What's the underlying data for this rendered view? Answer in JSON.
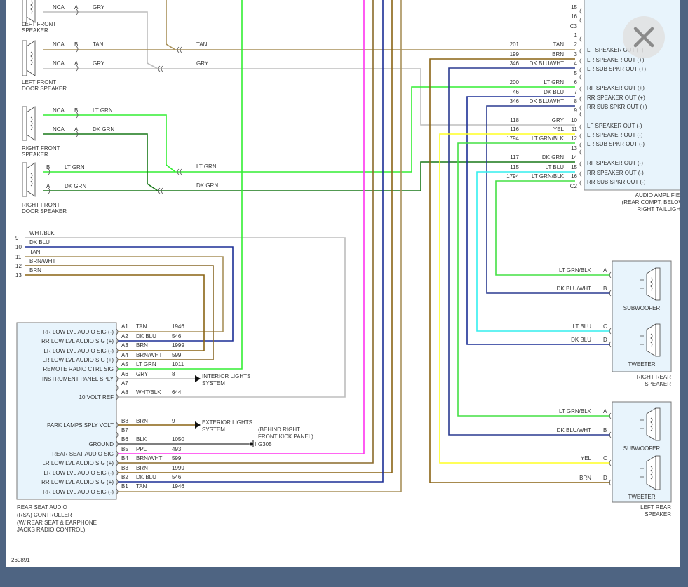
{
  "viewer": {
    "close_icon": "close-icon"
  },
  "wire_colors": {
    "TAN": "#a8915a",
    "BRN": "#8a6414",
    "BRN/WHT": "#8a6a2a",
    "DK BLU": "#1c2e96",
    "DK BLU/WHT": "#2a3a90",
    "LT GRN": "#33ee33",
    "LT GRN/BLK": "#44e044",
    "DK GRN": "#187818",
    "GRY": "#bdbdbd",
    "WHT/BLK": "#bdbdbd",
    "YEL": "#ffff22",
    "LT BLU": "#33eeee",
    "PPL": "#ff33ee",
    "BLK": "#555555"
  },
  "diagram": {
    "id": "260891",
    "left_front_speaker": {
      "name": [
        "LEFT FRONT",
        "SPEAKER"
      ],
      "pins": [
        {
          "nca": "NCA",
          "pin": "A",
          "color": "GRY"
        }
      ]
    },
    "left_front_door_speaker": {
      "name": [
        "LEFT FRONT",
        "DOOR SPEAKER"
      ],
      "pins": [
        {
          "nca": "NCA",
          "pin": "B",
          "color": "TAN"
        },
        {
          "nca": "NCA",
          "pin": "A",
          "color": "GRY"
        }
      ]
    },
    "right_front_speaker": {
      "name": [
        "RIGHT FRONT",
        "SPEAKER"
      ],
      "pins": [
        {
          "nca": "NCA",
          "pin": "B",
          "color": "LT GRN"
        },
        {
          "nca": "NCA",
          "pin": "A",
          "color": "DK GRN"
        }
      ]
    },
    "right_front_door_speaker": {
      "name": [
        "RIGHT FRONT",
        "DOOR SPEAKER"
      ],
      "pins": [
        {
          "pin": "B",
          "color": "LT GRN"
        },
        {
          "pin": "A",
          "color": "DK GRN"
        }
      ]
    },
    "inline_labels": [
      "TAN",
      "GRY",
      "LT GRN",
      "DK GRN"
    ],
    "harness": [
      {
        "num": "9",
        "color": "WHT/BLK"
      },
      {
        "num": "10",
        "color": "DK BLU"
      },
      {
        "num": "11",
        "color": "TAN"
      },
      {
        "num": "12",
        "color": "BRN/WHT"
      },
      {
        "num": "13",
        "color": "BRN"
      }
    ],
    "amplifier": {
      "name": [
        "AUDIO AMPLIFIER",
        "(REAR COMPT, BELOW",
        "RIGHT TAILLIGHT"
      ],
      "connectors": [
        "C3",
        "C2"
      ],
      "pins": [
        {
          "num": "15"
        },
        {
          "num": "16"
        },
        {
          "num": "1"
        },
        {
          "num": "2",
          "circuit": "201",
          "color": "TAN",
          "function": "LF SPEAKER OUT (+)"
        },
        {
          "num": "3",
          "circuit": "199",
          "color": "BRN",
          "function": "LR SPEAKER OUT (+)"
        },
        {
          "num": "4",
          "circuit": "346",
          "color": "DK BLU/WHT",
          "function": "LR SUB SPKR OUT (+)"
        },
        {
          "num": "5"
        },
        {
          "num": "6",
          "circuit": "200",
          "color": "LT GRN",
          "function": "RF SPEAKER OUT (+)"
        },
        {
          "num": "7",
          "circuit": "46",
          "color": "DK BLU",
          "function": "RR SPEAKER OUT (+)"
        },
        {
          "num": "8",
          "circuit": "346",
          "color": "DK BLU/WHT",
          "function": "RR SUB SPKR OUT (+)"
        },
        {
          "num": "9"
        },
        {
          "num": "10",
          "circuit": "118",
          "color": "GRY",
          "function": "LF SPEAKER OUT (-)"
        },
        {
          "num": "11",
          "circuit": "116",
          "color": "YEL",
          "function": "LR SPEAKER OUT (-)"
        },
        {
          "num": "12",
          "circuit": "1794",
          "color": "LT GRN/BLK",
          "function": "LR SUB SPKR OUT (-)"
        },
        {
          "num": "13"
        },
        {
          "num": "14",
          "circuit": "117",
          "color": "DK GRN",
          "function": "RF SPEAKER OUT (-)"
        },
        {
          "num": "15",
          "circuit": "115",
          "color": "LT BLU",
          "function": "RR SPEAKER OUT (-)"
        },
        {
          "num": "16",
          "circuit": "1794",
          "color": "LT GRN/BLK",
          "function": "RR SUB SPKR OUT (-)"
        }
      ]
    },
    "right_rear_speaker": {
      "name": [
        "RIGHT REAR",
        "SPEAKER"
      ],
      "subwoofer": "SUBWOOFER",
      "tweeter": "TWEETER",
      "pins": [
        {
          "pin": "A",
          "color": "LT GRN/BLK"
        },
        {
          "pin": "B",
          "color": "DK BLU/WHT"
        },
        {
          "pin": "C",
          "color": "LT BLU"
        },
        {
          "pin": "D",
          "color": "DK BLU"
        }
      ]
    },
    "left_rear_speaker": {
      "name": [
        "LEFT REAR",
        "SPEAKER"
      ],
      "subwoofer": "SUBWOOFER",
      "tweeter": "TWEETER",
      "pins": [
        {
          "pin": "A",
          "color": "LT GRN/BLK"
        },
        {
          "pin": "B",
          "color": "DK BLU/WHT"
        },
        {
          "pin": "C",
          "color": "YEL"
        },
        {
          "pin": "D",
          "color": "BRN"
        }
      ]
    },
    "rsa_controller": {
      "name": [
        "REAR SEAT AUDIO",
        "(RSA) CONTROLLER",
        "(W/ REAR SEAT & EARPHONE",
        "JACKS RADIO CONTROL)"
      ],
      "pins": [
        {
          "pin": "A1",
          "color": "TAN",
          "circuit": "1946",
          "function": "RR LOW LVL AUDIO SIG (-)"
        },
        {
          "pin": "A2",
          "color": "DK BLU",
          "circuit": "546",
          "function": "RR LOW LVL AUDIO SIG (+)"
        },
        {
          "pin": "A3",
          "color": "BRN",
          "circuit": "1999",
          "function": "LR LOW LVL AUDIO SIG (-)"
        },
        {
          "pin": "A4",
          "color": "BRN/WHT",
          "circuit": "599",
          "function": "LR LOW LVL AUDIO SIG (+)"
        },
        {
          "pin": "A5",
          "color": "LT GRN",
          "circuit": "1011",
          "function": "REMOTE RADIO CTRL SIG"
        },
        {
          "pin": "A6",
          "color": "GRY",
          "circuit": "8",
          "function": "INSTRUMENT PANEL SPLY"
        },
        {
          "pin": "A7"
        },
        {
          "pin": "A8",
          "color": "WHT/BLK",
          "circuit": "644",
          "function": "10 VOLT REF"
        },
        {
          "pin": "B8",
          "color": "BRN",
          "circuit": "9",
          "function": "PARK LAMPS SPLY VOLT"
        },
        {
          "pin": "B7"
        },
        {
          "pin": "B6",
          "color": "BLK",
          "circuit": "1050",
          "function": "GROUND"
        },
        {
          "pin": "B5",
          "color": "PPL",
          "circuit": "493",
          "function": "REAR SEAT AUDIO SIG"
        },
        {
          "pin": "B4",
          "color": "BRN/WHT",
          "circuit": "599",
          "function": "LR LOW LVL AUDIO SIG (+)"
        },
        {
          "pin": "B3",
          "color": "BRN",
          "circuit": "1999",
          "function": "LR LOW LVL AUDIO SIG (-)"
        },
        {
          "pin": "B2",
          "color": "DK BLU",
          "circuit": "546",
          "function": "RR LOW LVL AUDIO SIG (+)"
        },
        {
          "pin": "B1",
          "color": "TAN",
          "circuit": "1946",
          "function": "RR LOW LVL AUDIO SIG (-)"
        }
      ]
    },
    "interior_lights": [
      "INTERIOR LIGHTS",
      "SYSTEM"
    ],
    "exterior_lights": [
      "EXTERIOR LIGHTS",
      "SYSTEM"
    ],
    "ground": {
      "location": [
        "(BEHIND RIGHT",
        "FRONT KICK PANEL)"
      ],
      "id": "G305"
    }
  }
}
